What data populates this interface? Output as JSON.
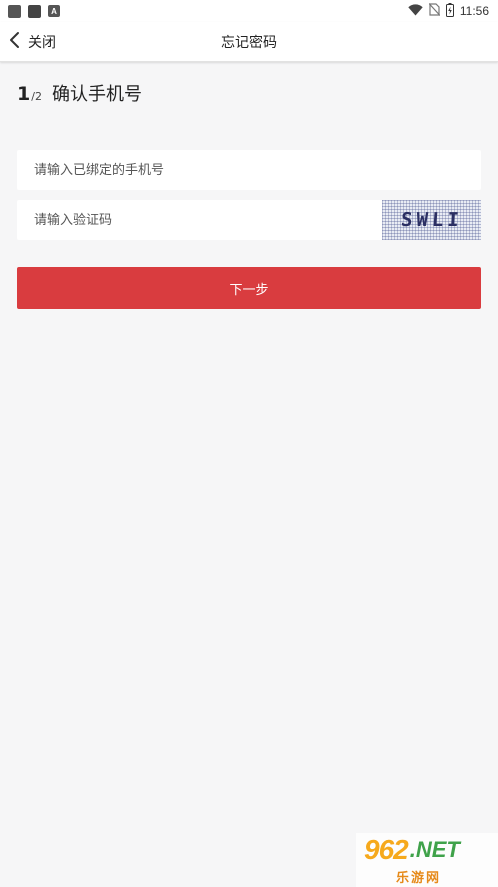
{
  "status_bar": {
    "time": "11:56",
    "app_icon_letter": "A",
    "icons": [
      "notification-square-icon",
      "notification-square-icon",
      "app-a-icon",
      "wifi-icon",
      "no-sim-icon",
      "battery-charging-icon"
    ]
  },
  "nav": {
    "back_label": "关闭",
    "title": "忘记密码"
  },
  "step": {
    "current": "1",
    "total": "/2",
    "title": "确认手机号"
  },
  "form": {
    "phone_placeholder": "请输入已绑定的手机号",
    "captcha_placeholder": "请输入验证码",
    "captcha_text": "SWLI"
  },
  "actions": {
    "next_label": "下一步"
  },
  "colors": {
    "primary_button": "#d93c3f",
    "background": "#f6f6f7"
  },
  "watermark": {
    "brand_number": "962",
    "brand_suffix": ".NET",
    "brand_sub": "乐游网"
  }
}
